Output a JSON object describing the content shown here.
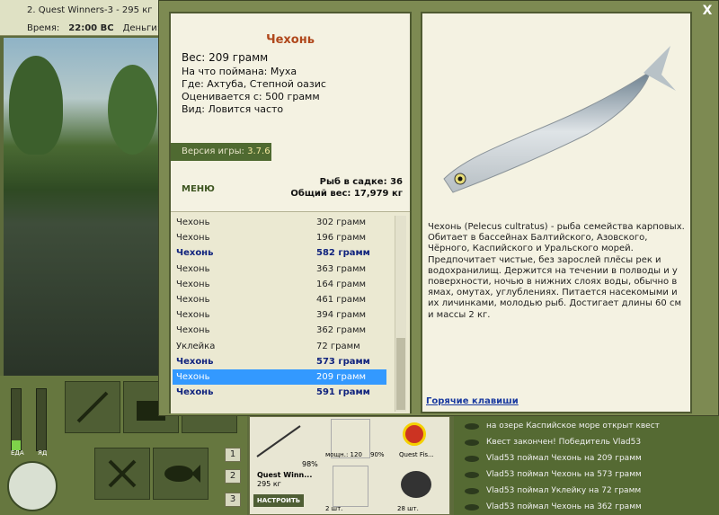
{
  "topbar": {
    "title": "2. Quest Winners-3 - 295 кг",
    "time_label": "Время:",
    "time_value": "22:00 ВС",
    "money_label": "Деньги:",
    "money_value": "..."
  },
  "gauges": {
    "left_label": "ЕДА",
    "right_label": "ЯД"
  },
  "slots": [
    "1",
    "2",
    "3"
  ],
  "inventory": {
    "rod_name": "Quest Winn...",
    "rod_weight": "295 кг",
    "rod_percent": "98%",
    "reel_label": "мощн.: 120",
    "reel_percent": "90%",
    "line_label": "Quest Fis...",
    "hook_count": "2 шт.",
    "bait_count": "28 шт.",
    "setup_button": "НАСТРОИТЬ"
  },
  "chat": [
    "на озере Каспийское море открыт квест",
    "Квест закончен! Победитель Vlad53",
    "Vlad53 поймал Чехонь на 209 грамм",
    "Vlad53 поймал Чехонь на 573 грамм",
    "Vlad53 поймал Уклейку на 72 грамм",
    "Vlad53 поймал Чехонь на 362 грамм"
  ],
  "dialog": {
    "close": "X"
  },
  "fish": {
    "name": "Чехонь",
    "weight": "Вес: 209 грамм",
    "bait": "На что поймана: Муха",
    "where": "Где: Ахтуба, Степной оазис",
    "value": "Оценивается с: 500 грамм",
    "kind": "Вид: Ловится часто"
  },
  "version": {
    "label": "Версия игры:",
    "value": "3.7.6"
  },
  "menu": "МЕНЮ",
  "keep": {
    "count": "Рыб в садке: 36",
    "total": "Общий вес: 17,979 кг"
  },
  "catch_list": [
    {
      "name": "Чехонь",
      "weight": "302 грамм",
      "big": false,
      "selected": false
    },
    {
      "name": "Чехонь",
      "weight": "196 грамм",
      "big": false,
      "selected": false
    },
    {
      "name": "Чехонь",
      "weight": "582 грамм",
      "big": true,
      "selected": false
    },
    {
      "name": "Чехонь",
      "weight": "363 грамм",
      "big": false,
      "selected": false
    },
    {
      "name": "Чехонь",
      "weight": "164 грамм",
      "big": false,
      "selected": false
    },
    {
      "name": "Чехонь",
      "weight": "461 грамм",
      "big": false,
      "selected": false
    },
    {
      "name": "Чехонь",
      "weight": "394 грамм",
      "big": false,
      "selected": false
    },
    {
      "name": "Чехонь",
      "weight": "362 грамм",
      "big": false,
      "selected": false
    },
    {
      "name": "Уклейка",
      "weight": "72 грамм",
      "big": false,
      "selected": false
    },
    {
      "name": "Чехонь",
      "weight": "573 грамм",
      "big": true,
      "selected": false
    },
    {
      "name": "Чехонь",
      "weight": "209 грамм",
      "big": false,
      "selected": true
    },
    {
      "name": "Чехонь",
      "weight": "591 грамм",
      "big": true,
      "selected": false
    }
  ],
  "description": "Чехонь (Pelecus cultratus) - рыба семейства карповых. Обитает в бассейнах Балтийского, Азовского, Чёрного, Каспийского и Уральского морей. Предпочитает чистые, без зарослей плёсы рек и водохранилищ. Держится на течении в полводы и у поверхности, ночью в нижних слоях воды, обычно в ямах, омутах, углублениях. Питается насекомыми и их личинками, молодью рыб. Достигает длины 60 см и массы 2 кг.",
  "hotkeys": "Горячие клавиши",
  "colors": {
    "accent": "#b0481c",
    "big_catch": "#10237e",
    "selected": "#3399ff",
    "panel": "#f4f2e2",
    "frame": "#7d8a52"
  }
}
